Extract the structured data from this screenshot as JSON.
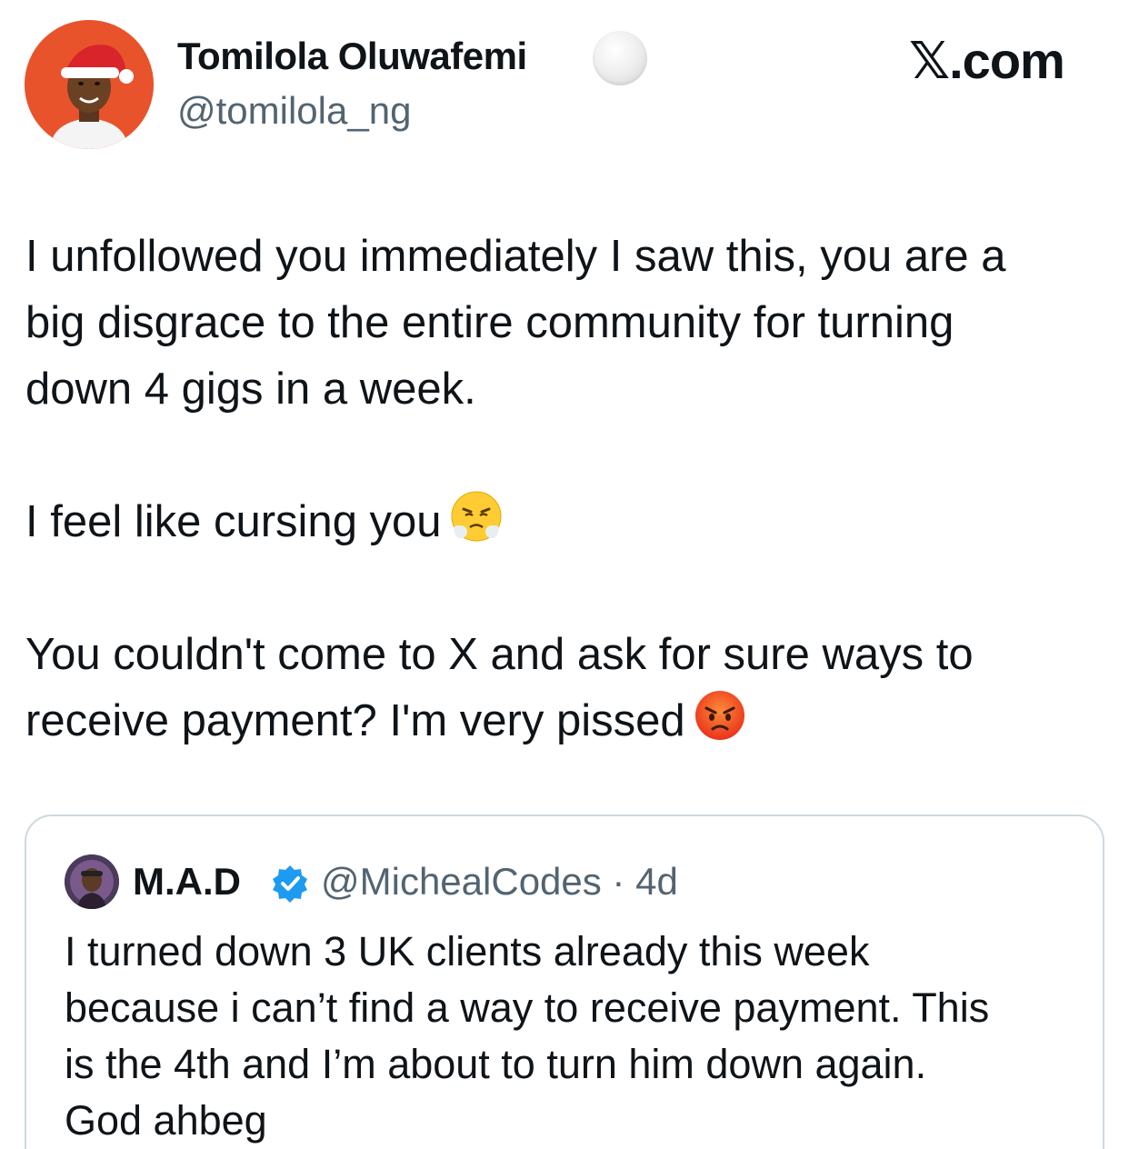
{
  "header": {
    "author_name": "Tomilola Oluwafemi",
    "author_handle": "@tomilola_ng",
    "brand": "𝕏.com"
  },
  "tweet": {
    "lines_para1": [
      "I unfollowed you immediately I saw this, you are a",
      "big disgrace to the entire community for turning",
      "down 4 gigs in a week."
    ],
    "para2_text": "I feel like cursing you",
    "para2_emoji": "face-with-steam-from-nose",
    "para3_line1": "You couldn't come to X and ask for sure ways to",
    "para3_line2": "receive payment? I'm very pissed",
    "para3_emoji": "pouting-face"
  },
  "quote": {
    "name": "M.A.D",
    "handle_time": "@MichealCodes · 4d",
    "lines": [
      "I turned down 3 UK clients already this week",
      "because i can’t find a way to receive payment. This",
      "is the 4th and I’m about to turn him down again.",
      "God ahbeg"
    ]
  },
  "colors": {
    "text": "#0f1419",
    "secondary": "#536471",
    "border": "#cfd9de",
    "verified_blue": "#1d9bf0",
    "avatar_bg": "#e8532c"
  }
}
